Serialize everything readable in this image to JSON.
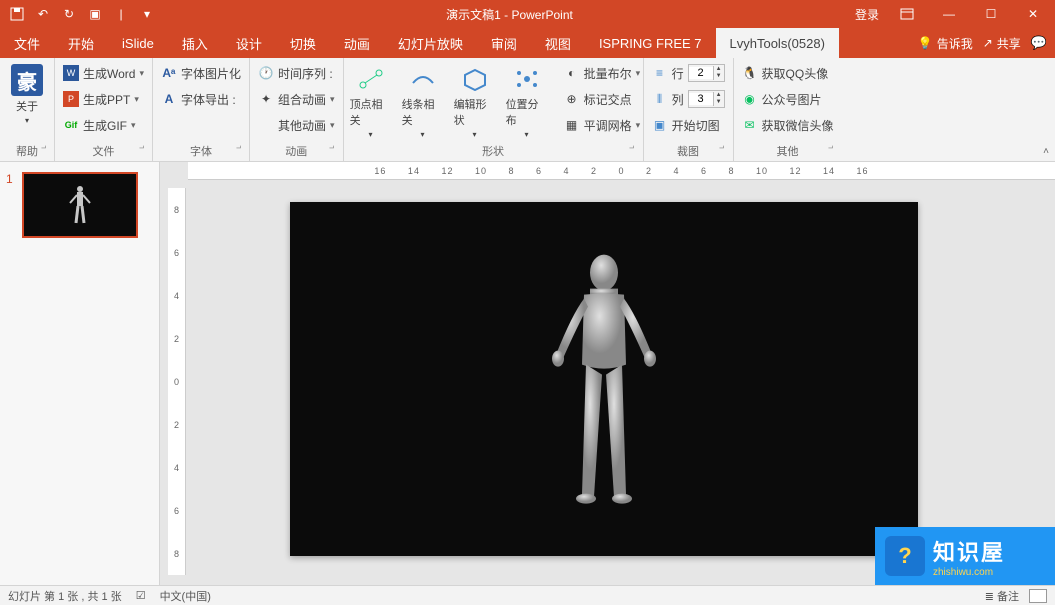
{
  "title": "演示文稿1 - PowerPoint",
  "login": "登录",
  "menu": {
    "file": "文件",
    "home": "开始",
    "islide": "iSlide",
    "insert": "插入",
    "design": "设计",
    "transition": "切换",
    "animation": "动画",
    "slideshow": "幻灯片放映",
    "review": "审阅",
    "view": "视图",
    "ispring": "ISPRING FREE 7",
    "lvyh": "LvyhTools(0528)",
    "tellme": "告诉我",
    "share": "共享"
  },
  "ribbon": {
    "g1": {
      "about": "关于",
      "label": "帮助"
    },
    "g2": {
      "word": "生成Word",
      "ppt": "生成PPT",
      "gif": "生成GIF",
      "label": "文件",
      "fontpic": "字体图片化",
      "fontexp": "字体导出 :",
      "label2": "字体"
    },
    "g3": {
      "seq": "时间序列 :",
      "combo": "组合动画",
      "other": "其他动画",
      "label": "动画"
    },
    "g4": {
      "vertex": "顶点相关",
      "line": "线条相关",
      "edit": "编辑形状",
      "pos": "位置分布",
      "batch": "批量布尔",
      "mark": "标记交点",
      "grid": "平调网格",
      "label": "形状"
    },
    "g5": {
      "row": "行",
      "col": "列",
      "rowv": "2",
      "colv": "3",
      "cut": "开始切图",
      "label": "裁图"
    },
    "g6": {
      "qq": "获取QQ头像",
      "gzh": "公众号图片",
      "wx": "获取微信头像",
      "label": "其他"
    }
  },
  "ruler": "16 14 12 10 8 6 4 2 0 2 4 6 8 10 12 14 16",
  "vruler": [
    "8",
    "6",
    "4",
    "2",
    "0",
    "2",
    "4",
    "6",
    "8"
  ],
  "thumb_num": "1",
  "status": {
    "slide": "幻灯片 第 1 张 , 共 1 张",
    "lang": "中文(中国)",
    "notes": "备注"
  },
  "wm": {
    "main": "知识屋",
    "sub": "zhishiwu.com"
  }
}
